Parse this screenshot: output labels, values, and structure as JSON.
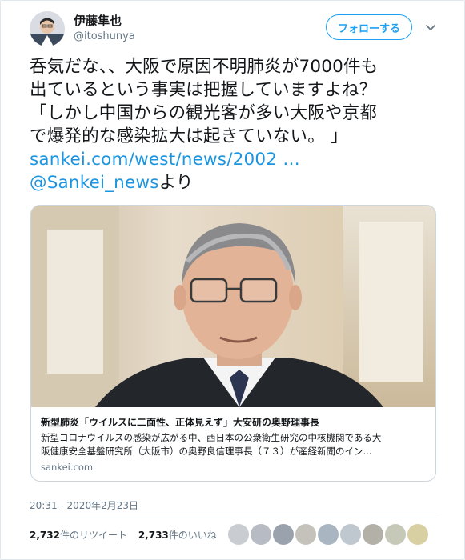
{
  "user": {
    "display_name": "伊藤隼也",
    "handle": "@itoshunya"
  },
  "follow_button": {
    "label": "フォローする"
  },
  "tweet": {
    "lines": [
      "呑気だな、、大阪で原因不明肺炎が7000件も",
      "出ているという事実は把握していますよね？",
      "「しかし中国からの観光客が多い大阪や京都",
      "で爆発的な感染拡大は起きていない。 」"
    ],
    "link_url": "sankei.com/west/news/2002 …",
    "mention": "@Sankei_news",
    "mention_suffix": "より"
  },
  "card": {
    "title": "新型肺炎「ウイルスに二面性、正体見えず」大安研の奥野理事長",
    "description_lines": [
      "新型コロナウイルスの感染が広がる中、西日本の公衆衛生研究の中核機関である大",
      "阪健康安全基盤研究所（大阪市）の奥野良信理事長（７３）が産経新聞のイン..."
    ],
    "domain": "sankei.com"
  },
  "timestamp": "20:31 - 2020年2月23日",
  "stats": {
    "retweets_count": "2,732",
    "retweets_label": "件のリツイート",
    "likes_count": "2,733",
    "likes_label": "件のいいね"
  },
  "colors": {
    "accent": "#1da1f2",
    "link": "#1b95e0",
    "muted": "#657786"
  }
}
